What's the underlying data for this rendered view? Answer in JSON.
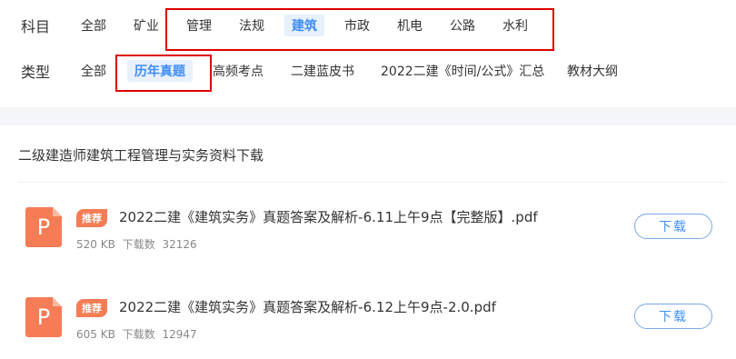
{
  "subject": {
    "label": "科目",
    "options": [
      "全部",
      "矿业",
      "管理",
      "法规",
      "建筑",
      "市政",
      "机电",
      "公路",
      "水利"
    ],
    "active": "建筑"
  },
  "type": {
    "label": "类型",
    "options": [
      "全部",
      "历年真题",
      "高频考点",
      "二建蓝皮书",
      "2022二建《时间/公式》汇总",
      "教材大纲"
    ],
    "active": "历年真题"
  },
  "section": {
    "title": "二级建造师建筑工程管理与实务资料下载"
  },
  "files": [
    {
      "icon_letter": "P",
      "badge": "推荐",
      "name": "2022二建《建筑实务》真题答案及解析-6.11上午9点【完整版】.pdf",
      "size": "520 KB",
      "downloads_label": "下载数",
      "downloads": "32126",
      "button": "下载"
    },
    {
      "icon_letter": "P",
      "badge": "推荐",
      "name": "2022二建《建筑实务》真题答案及解析-6.12上午9点-2.0.pdf",
      "size": "605 KB",
      "downloads_label": "下载数",
      "downloads": "12947",
      "button": "下载"
    }
  ],
  "colors": {
    "accent": "#3e8ef7",
    "highlight_box": "#e00000",
    "file_icon": "#f57c55"
  }
}
